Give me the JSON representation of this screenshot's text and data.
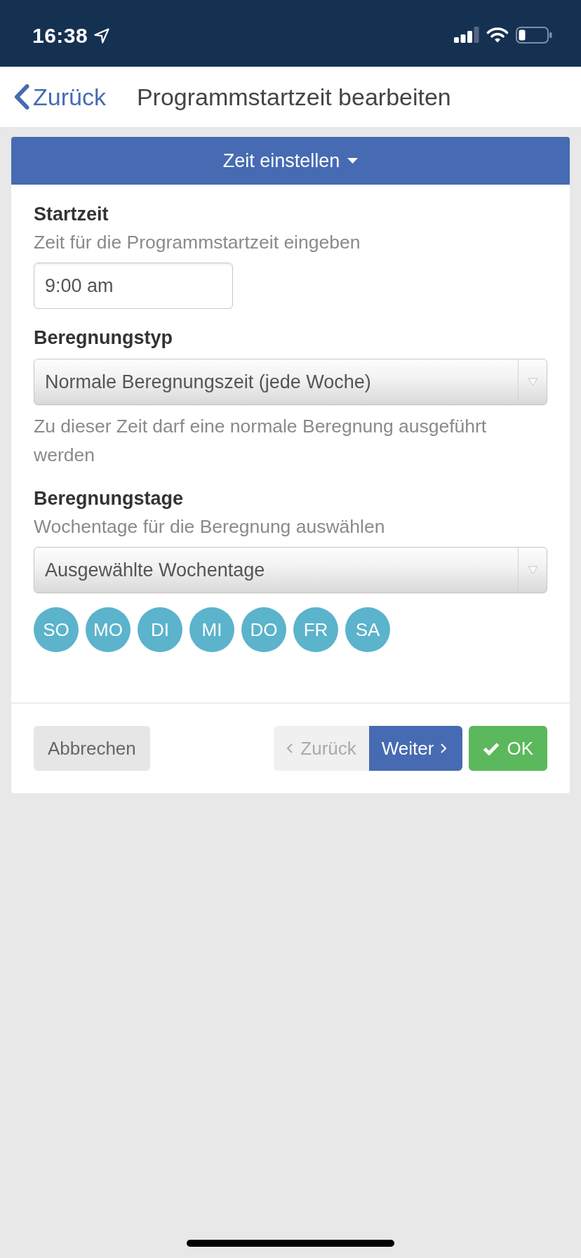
{
  "status_bar": {
    "time": "16:38"
  },
  "nav_bar": {
    "back_label": "Zurück",
    "title": "Programmstartzeit bearbeiten"
  },
  "card": {
    "header": {
      "label": "Zeit einstellen"
    },
    "fields": [
      {
        "kind": "time",
        "label": "Startzeit",
        "help": "Zeit für die Programmstartzeit eingeben",
        "value": "9:00 am"
      },
      {
        "kind": "select",
        "label": "Beregnungstyp",
        "value": "Normale Beregnungszeit (jede Woche)",
        "note": "Zu dieser Zeit darf eine normale Beregnung ausgeführt werden"
      },
      {
        "kind": "days",
        "label": "Beregnungstage",
        "help": "Wochentage für die Beregnung auswählen",
        "value": "Ausgewählte Wochentage",
        "days": [
          {
            "label": "SO",
            "selected": true
          },
          {
            "label": "MO",
            "selected": true
          },
          {
            "label": "DI",
            "selected": true
          },
          {
            "label": "MI",
            "selected": true
          },
          {
            "label": "DO",
            "selected": true
          },
          {
            "label": "FR",
            "selected": true
          },
          {
            "label": "SA",
            "selected": true
          }
        ]
      }
    ],
    "buttons": [
      {
        "kind": "cancel",
        "label": "Abbrechen",
        "disabled": false
      },
      {
        "kind": "prev",
        "label": "Zurück",
        "disabled": true
      },
      {
        "kind": "next",
        "label": "Weiter",
        "disabled": false
      },
      {
        "kind": "confirm",
        "label": "OK",
        "disabled": false
      }
    ]
  }
}
